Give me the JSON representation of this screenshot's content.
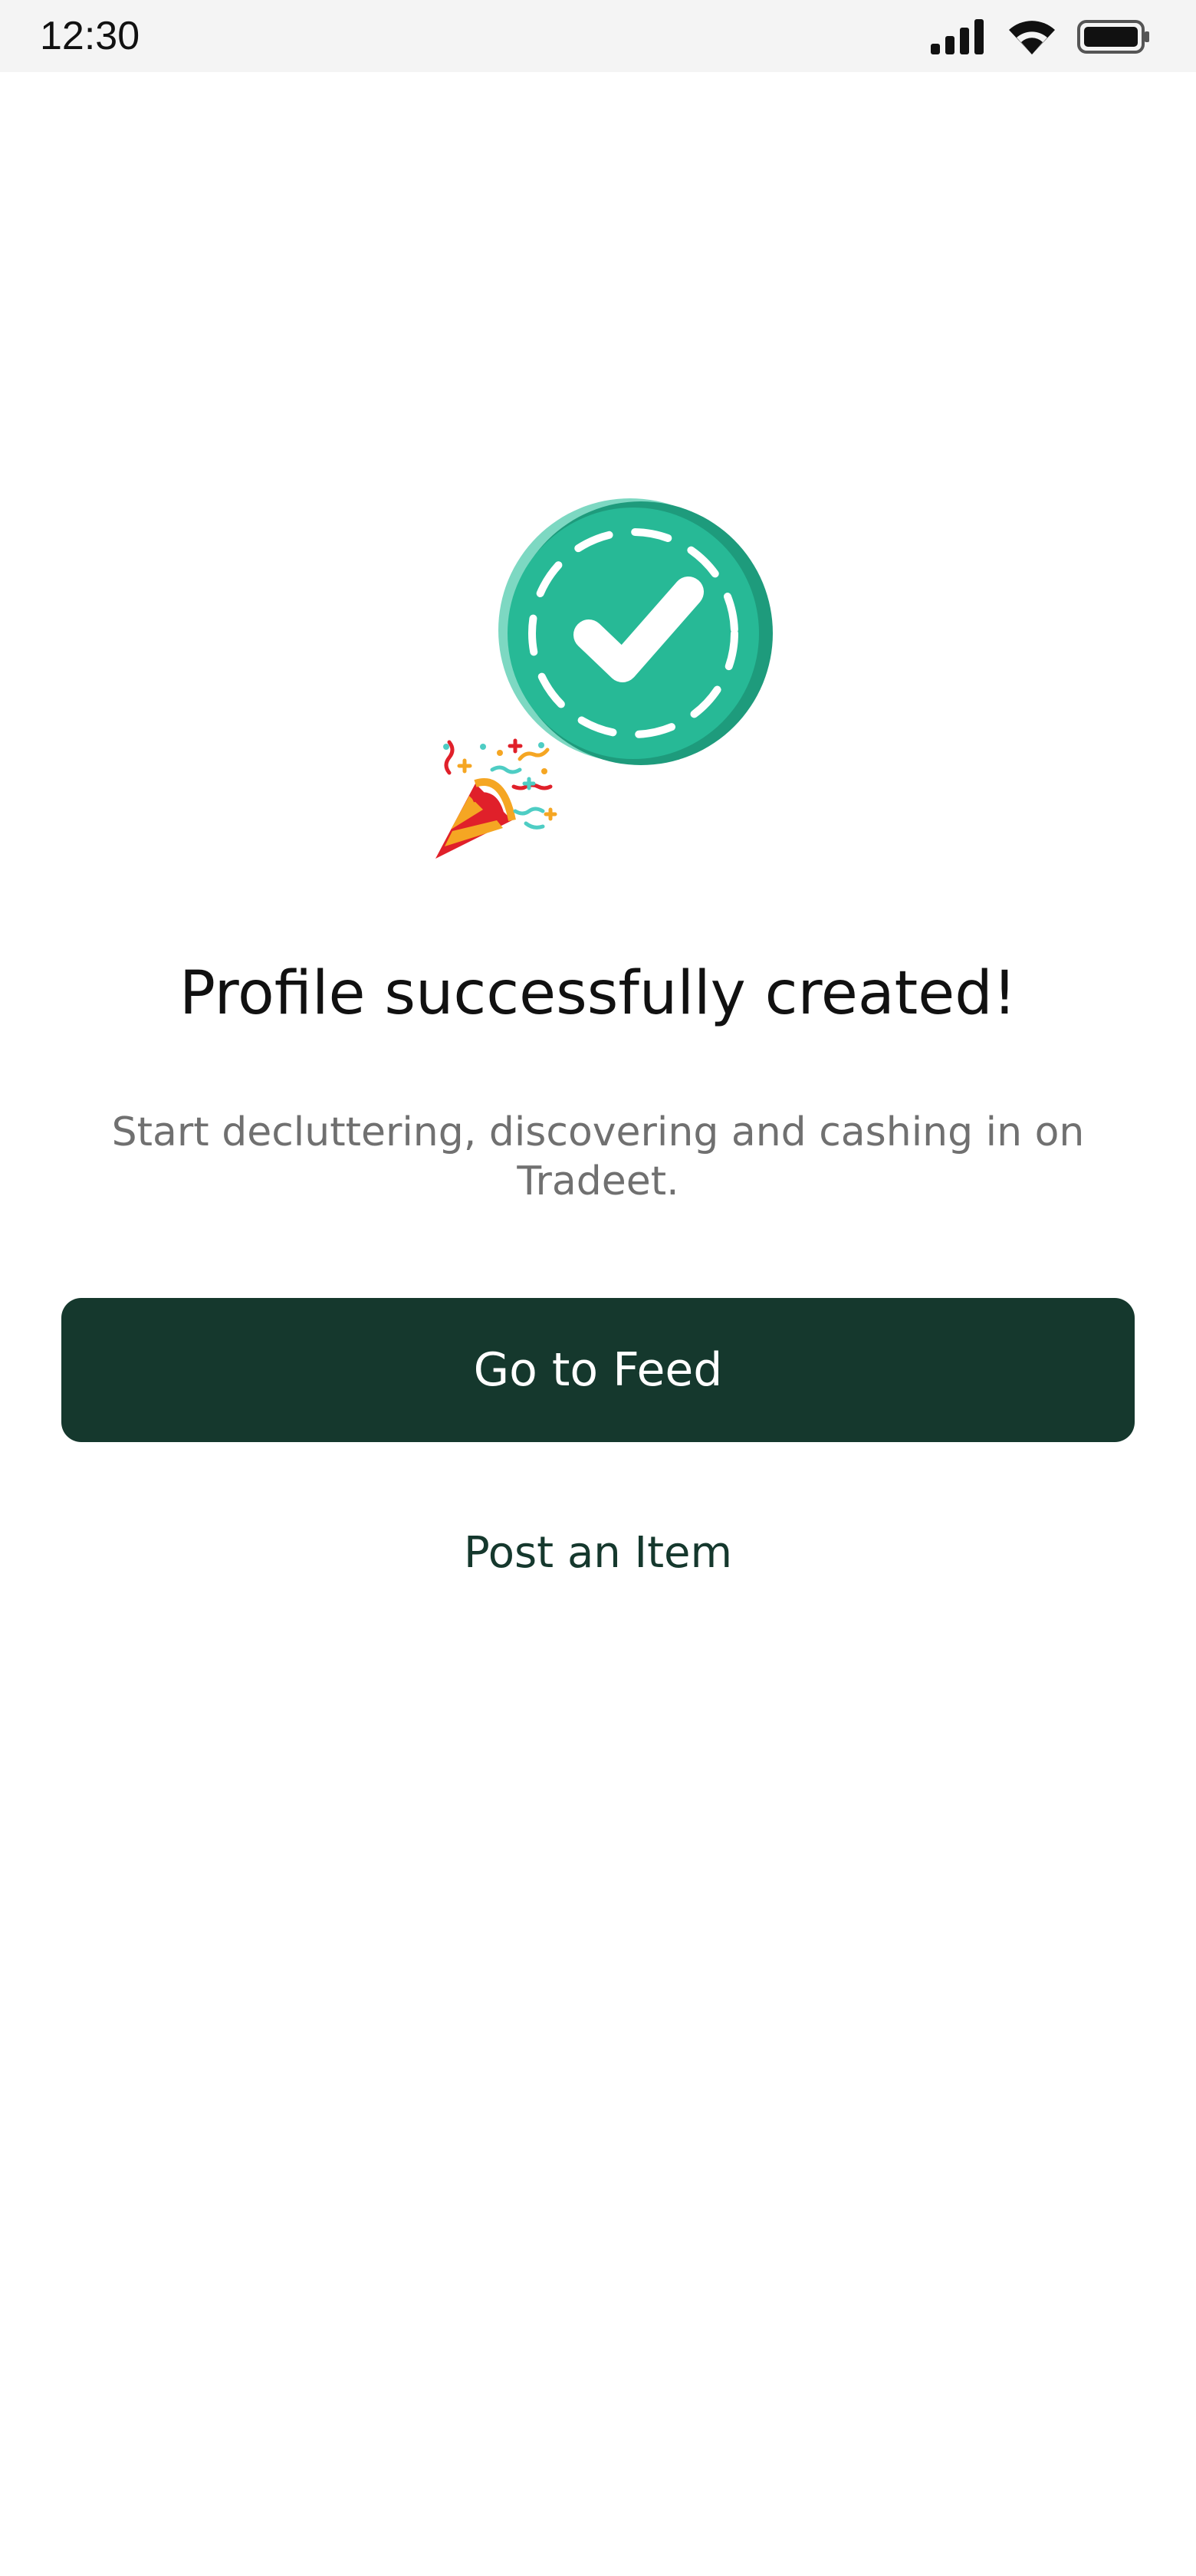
{
  "status_bar": {
    "time": "12:30",
    "icons": [
      "signal-icon",
      "wifi-icon",
      "battery-icon"
    ]
  },
  "illustration": {
    "icons": [
      "check-circle-icon",
      "party-popper-icon"
    ],
    "colors": {
      "check_circle": "#27b996",
      "check_circle_shadow": "#1e9b7c",
      "popper_red": "#e0202a",
      "popper_orange": "#f5a623"
    }
  },
  "content": {
    "title": "Profile successfully created!",
    "subtitle": "Start decluttering, discovering and cashing in on Tradeet."
  },
  "actions": {
    "primary_label": "Go to Feed",
    "secondary_label": "Post an Item"
  },
  "colors": {
    "primary_button_bg": "#15382d",
    "secondary_text": "#15382d",
    "subtitle_text": "#707070"
  }
}
